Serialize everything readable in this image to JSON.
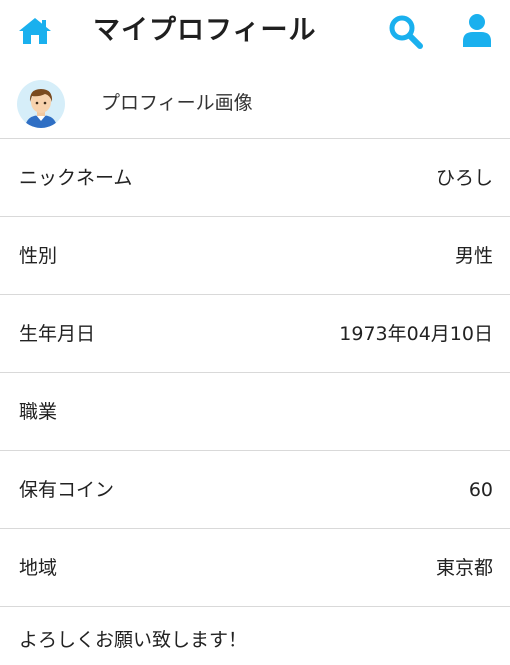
{
  "header": {
    "title": "マイプロフィール",
    "home_icon": "home-icon",
    "search_icon": "search-icon",
    "user_icon": "user-icon",
    "accent_color": "#1ab0ee"
  },
  "profile_image": {
    "label": "プロフィール画像",
    "avatar_icon": "avatar-boy-icon"
  },
  "fields": [
    {
      "label": "ニックネーム",
      "value": "ひろし"
    },
    {
      "label": "性別",
      "value": "男性"
    },
    {
      "label": "生年月日",
      "value": "1973年04月10日"
    },
    {
      "label": "職業",
      "value": ""
    },
    {
      "label": "保有コイン",
      "value": "60"
    },
    {
      "label": "地域",
      "value": "東京都"
    }
  ],
  "message": "よろしくお願い致します！"
}
